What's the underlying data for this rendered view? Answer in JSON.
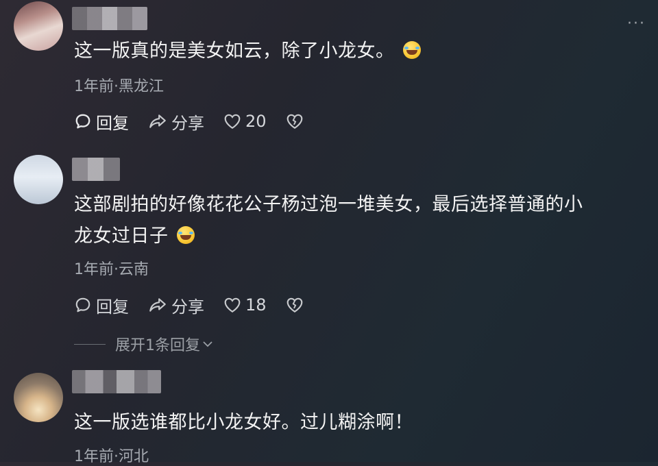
{
  "comments": [
    {
      "text": "这一版真的是美女如云，除了小龙女。",
      "meta": "1年前·黑龙江",
      "reply_label": "回复",
      "share_label": "分享",
      "likes": "20"
    },
    {
      "text_line1": "这部剧拍的好像花花公子杨过泡一堆美女，最后选择普通的小",
      "text_line2": "龙女过日子",
      "meta": "1年前·云南",
      "reply_label": "回复",
      "share_label": "分享",
      "likes": "18",
      "expand_label": "展开1条回复"
    },
    {
      "text": "这一版选谁都比小龙女好。过儿糊涂啊！",
      "meta": "1年前·河北"
    }
  ],
  "more_icon": "···",
  "colors": {
    "background": "#25262f",
    "text": "#f3f3f3",
    "meta": "#a7abb2"
  }
}
